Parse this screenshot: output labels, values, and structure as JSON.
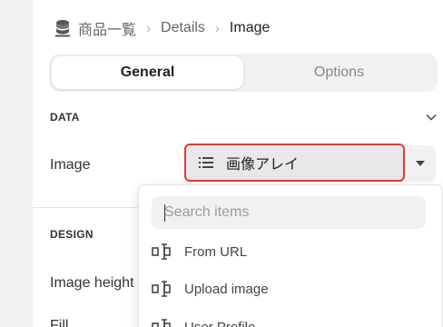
{
  "breadcrumb": {
    "items": [
      "商品一覧",
      "Details",
      "Image"
    ],
    "separator": "›"
  },
  "tabs": [
    {
      "label": "General",
      "active": true
    },
    {
      "label": "Options",
      "active": false
    }
  ],
  "sections": {
    "data": {
      "title": "DATA"
    },
    "design": {
      "title": "DESIGN"
    }
  },
  "fields": {
    "image_label": "Image",
    "image_value": "画像アレイ",
    "image_height_label": "Image height",
    "fill_label": "Fill"
  },
  "dropdown": {
    "search_placeholder": "Search items",
    "items": [
      {
        "label": "From URL",
        "icon": "text-cursor-icon"
      },
      {
        "label": "Upload image",
        "icon": "text-cursor-icon"
      },
      {
        "label": "User Profile",
        "icon": "text-cursor-icon"
      }
    ]
  },
  "colors": {
    "highlight_border": "#e53935",
    "panel_bg": "#ffffff",
    "gutter_bg": "#f1f1f3"
  }
}
